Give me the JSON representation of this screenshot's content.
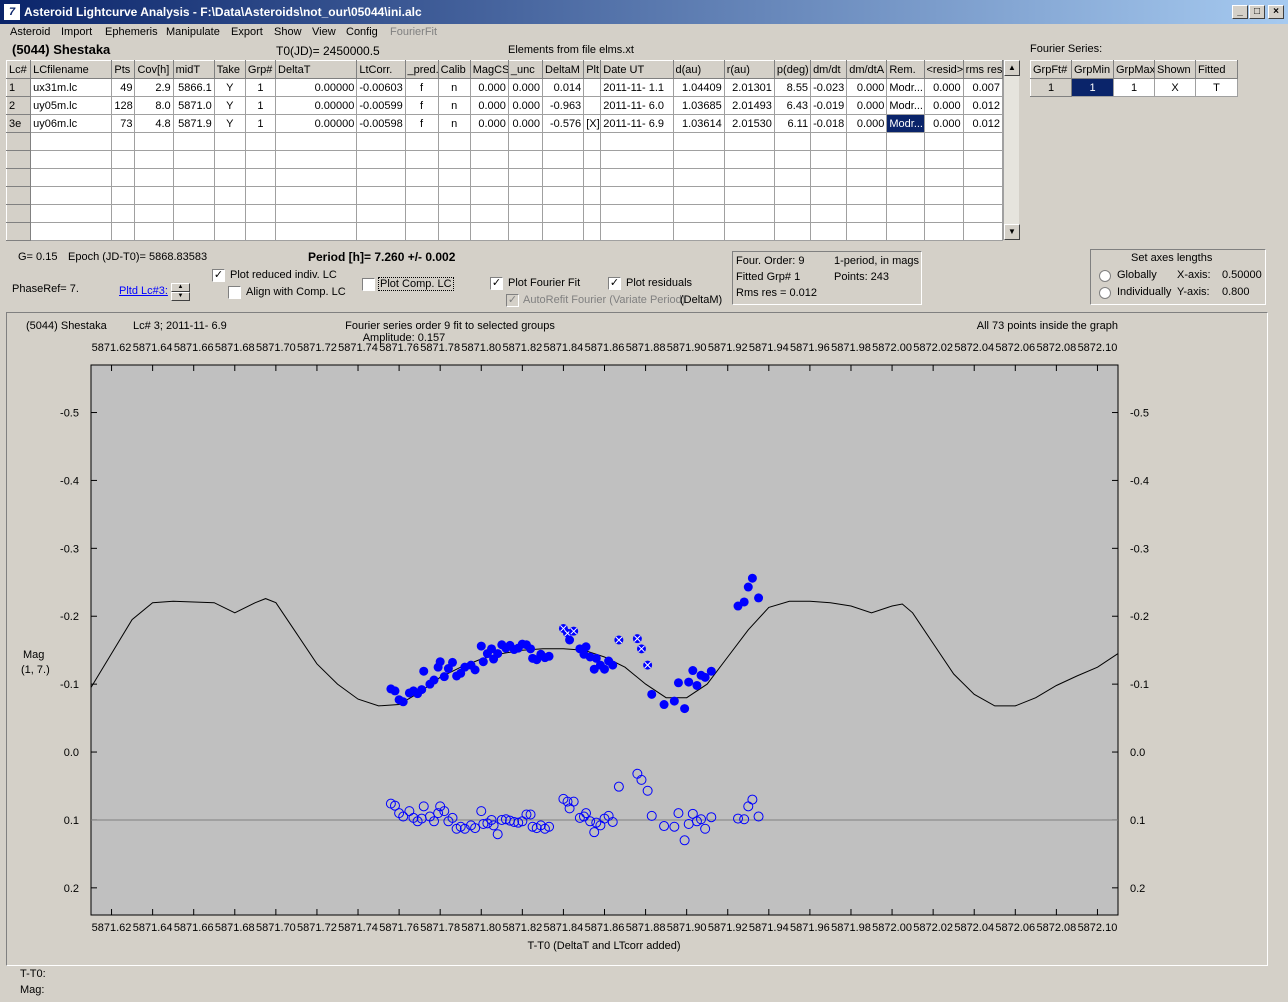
{
  "window": {
    "title": "Asteroid Lightcurve Analysis - F:\\Data\\Asteroids\\not_our\\05044\\ini.alc"
  },
  "menu": [
    "Asteroid",
    "Import",
    "Ephemeris",
    "Manipulate",
    "Export",
    "Show",
    "View",
    "Config",
    "FourierFit"
  ],
  "header": {
    "asteroid": "(5044) Shestaka",
    "t0": "T0(JD)= 2450000.5",
    "elements": "Elements from file elms.xt"
  },
  "lc_table": {
    "columns": [
      "Lc#",
      "LCfilename",
      "Pts",
      "Cov[h]",
      "midT",
      "Take",
      "Grp#",
      "DeltaT",
      "LtCorr.",
      "_pred.",
      "Calib",
      "MagCS",
      "_unc",
      "DeltaM",
      "Plt",
      "Date UT",
      "d(au)",
      "r(au)",
      "p(deg)",
      "dm/dt",
      "dm/dtA",
      "Rem.",
      "<resid>",
      "rms res"
    ],
    "rows": [
      [
        "1",
        "ux31m.lc",
        "49",
        "2.9",
        "5866.1",
        "Y",
        "1",
        "0.00000",
        "-0.00603",
        "f",
        "n",
        "0.000",
        "0.000",
        "0.014",
        "",
        "2011-11- 1.1",
        "1.04409",
        "2.01301",
        "8.55",
        "-0.023",
        "0.000",
        "Modr...",
        "0.000",
        "0.007"
      ],
      [
        "2",
        "uy05m.lc",
        "128",
        "8.0",
        "5871.0",
        "Y",
        "1",
        "0.00000",
        "-0.00599",
        "f",
        "n",
        "0.000",
        "0.000",
        "-0.963",
        "",
        "2011-11- 6.0",
        "1.03685",
        "2.01493",
        "6.43",
        "-0.019",
        "0.000",
        "Modr...",
        "0.000",
        "0.012"
      ],
      [
        "3e",
        "uy06m.lc",
        "73",
        "4.8",
        "5871.9",
        "Y",
        "1",
        "0.00000",
        "-0.00598",
        "f",
        "n",
        "0.000",
        "0.000",
        "-0.576",
        "[X]",
        "2011-11- 6.9",
        "1.03614",
        "2.01530",
        "6.11",
        "-0.018",
        "0.000",
        "Modr...",
        "0.000",
        "0.012"
      ]
    ]
  },
  "fourier_series": {
    "label": "Fourier Series:",
    "columns": [
      "GrpFt#",
      "GrpMin",
      "GrpMax",
      "Shown",
      "Fitted"
    ],
    "row": [
      "1",
      "1",
      "1",
      "X",
      "T"
    ]
  },
  "controls": {
    "g": "G= 0.15",
    "epoch": "Epoch (JD-T0)= 5868.83583",
    "period": "Period [h]= 7.260 +/- 0.002",
    "phaseref": "PhaseRef= 7.",
    "pltd_lc": "Pltd Lc#3:",
    "plot_reduced": "Plot reduced indiv. LC",
    "align_comp": "Align with Comp. LC",
    "plot_comp": "Plot Comp. LC",
    "plot_fourier": "Plot Fourier Fit",
    "plot_residuals": "Plot residuals",
    "autorefit": "AutoRefit Fourier (Variate Period)",
    "deltam": "(DeltaM)",
    "info": {
      "order": "Four. Order:  9",
      "fitted": "Fitted Grp# 1",
      "rms": "Rms res      = 0.012",
      "oneperiod": "1-period, in mags",
      "points": "Points: 243"
    },
    "axes": {
      "title": "Set axes lengths",
      "globally": "Globally",
      "individually": "Individually",
      "xaxis_label": "X-axis:",
      "xaxis_value": "0.50000",
      "yaxis_label": "Y-axis:",
      "yaxis_value": "0.800"
    }
  },
  "plot": {
    "header_left": "(5044) Shestaka",
    "header_lc": "Lc# 3; 2011-11- 6.9",
    "header_center": "Fourier series order 9 fit to selected groups",
    "amplitude": "Amplitude: 0.157",
    "header_right": "All 73 points inside the graph",
    "ylabel": "Mag",
    "ylabel2": "(1, 7.)",
    "xlabel": "T-T0 (DeltaT and LTcorr added)"
  },
  "status": {
    "t_t0": "T-T0:",
    "mag": "Mag:"
  },
  "chart_data": {
    "type": "scatter",
    "xlim": [
      5871.61,
      5872.11
    ],
    "ylim": [
      -0.57,
      0.24
    ],
    "y_inverted": true,
    "x_ticks": [
      "5871.62",
      "5871.64",
      "5871.66",
      "5871.68",
      "5871.70",
      "5871.72",
      "5871.74",
      "5871.76",
      "5871.78",
      "5871.80",
      "5871.82",
      "5871.84",
      "5871.86",
      "5871.88",
      "5871.90",
      "5871.92",
      "5871.94",
      "5871.96",
      "5871.98",
      "5872.00",
      "5872.02",
      "5872.04",
      "5872.06",
      "5872.08",
      "5872.10"
    ],
    "y_ticks": [
      "-0.5",
      "-0.4",
      "-0.3",
      "-0.2",
      "-0.1",
      "0.0",
      "0.1",
      "0.2"
    ],
    "residual_offset": 0.1,
    "colors": {
      "points": "#0000ff",
      "fit": "#000000",
      "background": "#c0c0c0"
    },
    "fourier_curve": [
      [
        5871.61,
        -0.095
      ],
      [
        5871.62,
        -0.145
      ],
      [
        5871.63,
        -0.195
      ],
      [
        5871.64,
        -0.22
      ],
      [
        5871.65,
        -0.222
      ],
      [
        5871.66,
        -0.221
      ],
      [
        5871.67,
        -0.22
      ],
      [
        5871.68,
        -0.205
      ],
      [
        5871.69,
        -0.22
      ],
      [
        5871.695,
        -0.226
      ],
      [
        5871.7,
        -0.22
      ],
      [
        5871.71,
        -0.175
      ],
      [
        5871.72,
        -0.13
      ],
      [
        5871.73,
        -0.1
      ],
      [
        5871.74,
        -0.078
      ],
      [
        5871.75,
        -0.068
      ],
      [
        5871.76,
        -0.07
      ],
      [
        5871.77,
        -0.088
      ],
      [
        5871.78,
        -0.11
      ],
      [
        5871.79,
        -0.125
      ],
      [
        5871.8,
        -0.137
      ],
      [
        5871.81,
        -0.145
      ],
      [
        5871.82,
        -0.15
      ],
      [
        5871.83,
        -0.152
      ],
      [
        5871.84,
        -0.152
      ],
      [
        5871.85,
        -0.15
      ],
      [
        5871.86,
        -0.14
      ],
      [
        5871.87,
        -0.125
      ],
      [
        5871.88,
        -0.1
      ],
      [
        5871.89,
        -0.08
      ],
      [
        5871.9,
        -0.08
      ],
      [
        5871.91,
        -0.1
      ],
      [
        5871.92,
        -0.14
      ],
      [
        5871.93,
        -0.18
      ],
      [
        5871.94,
        -0.213
      ],
      [
        5871.95,
        -0.222
      ],
      [
        5871.96,
        -0.222
      ],
      [
        5871.97,
        -0.22
      ],
      [
        5871.98,
        -0.215
      ],
      [
        5871.99,
        -0.205
      ],
      [
        5872.0,
        -0.215
      ],
      [
        5872.005,
        -0.218
      ],
      [
        5872.01,
        -0.205
      ],
      [
        5872.02,
        -0.16
      ],
      [
        5872.03,
        -0.115
      ],
      [
        5872.04,
        -0.085
      ],
      [
        5872.05,
        -0.068
      ],
      [
        5872.06,
        -0.068
      ],
      [
        5872.07,
        -0.08
      ],
      [
        5872.08,
        -0.098
      ],
      [
        5872.09,
        -0.112
      ],
      [
        5872.1,
        -0.125
      ],
      [
        5872.11,
        -0.145
      ]
    ],
    "points": [
      {
        "x": 5871.756,
        "y": -0.093,
        "r": 0.076
      },
      {
        "x": 5871.758,
        "y": -0.09,
        "r": 0.079
      },
      {
        "x": 5871.76,
        "y": -0.077,
        "r": 0.09
      },
      {
        "x": 5871.762,
        "y": -0.074,
        "r": 0.095
      },
      {
        "x": 5871.765,
        "y": -0.087,
        "r": 0.087
      },
      {
        "x": 5871.767,
        "y": -0.09,
        "r": 0.097
      },
      {
        "x": 5871.769,
        "y": -0.086,
        "r": 0.102
      },
      {
        "x": 5871.771,
        "y": -0.092,
        "r": 0.098
      },
      {
        "x": 5871.772,
        "y": -0.119,
        "r": 0.08
      },
      {
        "x": 5871.775,
        "y": -0.1,
        "r": 0.095
      },
      {
        "x": 5871.777,
        "y": -0.106,
        "r": 0.102
      },
      {
        "x": 5871.779,
        "y": -0.125,
        "r": 0.09
      },
      {
        "x": 5871.78,
        "y": -0.133,
        "r": 0.08
      },
      {
        "x": 5871.782,
        "y": -0.111,
        "r": 0.087
      },
      {
        "x": 5871.784,
        "y": -0.123,
        "r": 0.102
      },
      {
        "x": 5871.786,
        "y": -0.132,
        "r": 0.097
      },
      {
        "x": 5871.788,
        "y": -0.112,
        "r": 0.113
      },
      {
        "x": 5871.79,
        "y": -0.116,
        "r": 0.11
      },
      {
        "x": 5871.792,
        "y": -0.125,
        "r": 0.113
      },
      {
        "x": 5871.795,
        "y": -0.128,
        "r": 0.108
      },
      {
        "x": 5871.797,
        "y": -0.121,
        "r": 0.112
      },
      {
        "x": 5871.8,
        "y": -0.156,
        "r": 0.087
      },
      {
        "x": 5871.801,
        "y": -0.133,
        "r": 0.106
      },
      {
        "x": 5871.803,
        "y": -0.145,
        "r": 0.105
      },
      {
        "x": 5871.805,
        "y": -0.152,
        "r": 0.1
      },
      {
        "x": 5871.806,
        "y": -0.137,
        "r": 0.108
      },
      {
        "x": 5871.808,
        "y": -0.145,
        "r": 0.121
      },
      {
        "x": 5871.81,
        "y": -0.158,
        "r": 0.1
      },
      {
        "x": 5871.812,
        "y": -0.153,
        "r": 0.099
      },
      {
        "x": 5871.814,
        "y": -0.157,
        "r": 0.101
      },
      {
        "x": 5871.816,
        "y": -0.151,
        "r": 0.103
      },
      {
        "x": 5871.818,
        "y": -0.153,
        "r": 0.104
      },
      {
        "x": 5871.82,
        "y": -0.159,
        "r": 0.102
      },
      {
        "x": 5871.822,
        "y": -0.158,
        "r": 0.092
      },
      {
        "x": 5871.824,
        "y": -0.152,
        "r": 0.092
      },
      {
        "x": 5871.825,
        "y": -0.138,
        "r": 0.11
      },
      {
        "x": 5871.827,
        "y": -0.136,
        "r": 0.112
      },
      {
        "x": 5871.829,
        "y": -0.144,
        "r": 0.108
      },
      {
        "x": 5871.831,
        "y": -0.139,
        "r": 0.113
      },
      {
        "x": 5871.833,
        "y": -0.141,
        "r": 0.11
      },
      {
        "x": 5871.84,
        "y": -0.182,
        "r": 0.069
      },
      {
        "x": 5871.842,
        "y": -0.175,
        "r": 0.073
      },
      {
        "x": 5871.843,
        "y": -0.165,
        "r": 0.083
      },
      {
        "x": 5871.845,
        "y": -0.178,
        "r": 0.073
      },
      {
        "x": 5871.848,
        "y": -0.152,
        "r": 0.097
      },
      {
        "x": 5871.85,
        "y": -0.144,
        "r": 0.095
      },
      {
        "x": 5871.851,
        "y": -0.155,
        "r": 0.09
      },
      {
        "x": 5871.853,
        "y": -0.14,
        "r": 0.102
      },
      {
        "x": 5871.855,
        "y": -0.122,
        "r": 0.118
      },
      {
        "x": 5871.856,
        "y": -0.138,
        "r": 0.104
      },
      {
        "x": 5871.858,
        "y": -0.128,
        "r": 0.108
      },
      {
        "x": 5871.86,
        "y": -0.122,
        "r": 0.098
      },
      {
        "x": 5871.862,
        "y": -0.134,
        "r": 0.094
      },
      {
        "x": 5871.864,
        "y": -0.128,
        "r": 0.103
      },
      {
        "x": 5871.867,
        "y": -0.165,
        "r": 0.051
      },
      {
        "x": 5871.876,
        "y": -0.167,
        "r": 0.032
      },
      {
        "x": 5871.878,
        "y": -0.152,
        "r": 0.041
      },
      {
        "x": 5871.881,
        "y": -0.128,
        "r": 0.057
      },
      {
        "x": 5871.883,
        "y": -0.085,
        "r": 0.094
      },
      {
        "x": 5871.889,
        "y": -0.07,
        "r": 0.109
      },
      {
        "x": 5871.894,
        "y": -0.075,
        "r": 0.11
      },
      {
        "x": 5871.896,
        "y": -0.102,
        "r": 0.09
      },
      {
        "x": 5871.899,
        "y": -0.064,
        "r": 0.13
      },
      {
        "x": 5871.901,
        "y": -0.103,
        "r": 0.106
      },
      {
        "x": 5871.903,
        "y": -0.12,
        "r": 0.091
      },
      {
        "x": 5871.905,
        "y": -0.098,
        "r": 0.102
      },
      {
        "x": 5871.907,
        "y": -0.113,
        "r": 0.099
      },
      {
        "x": 5871.909,
        "y": -0.11,
        "r": 0.113
      },
      {
        "x": 5871.912,
        "y": -0.119,
        "r": 0.096
      },
      {
        "x": 5871.925,
        "y": -0.215,
        "r": 0.098
      },
      {
        "x": 5871.928,
        "y": -0.221,
        "r": 0.099
      },
      {
        "x": 5871.93,
        "y": -0.243,
        "r": 0.08
      },
      {
        "x": 5871.932,
        "y": -0.256,
        "r": 0.07
      },
      {
        "x": 5871.935,
        "y": -0.227,
        "r": 0.095
      }
    ],
    "crossed_points": [
      5871.84,
      5871.842,
      5871.845,
      5871.867,
      5871.876,
      5871.878,
      5871.881
    ]
  }
}
